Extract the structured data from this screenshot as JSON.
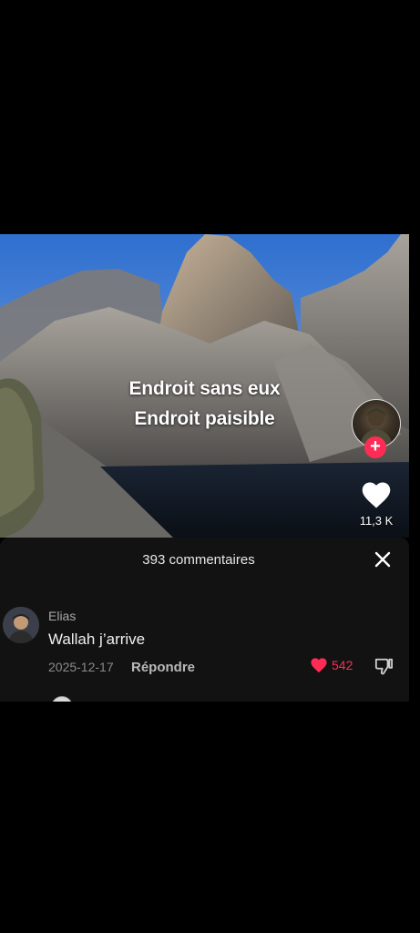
{
  "video": {
    "caption_line1": "Endroit sans eux",
    "caption_line2": "Endroit paisible",
    "like_count": "11,3 K"
  },
  "comments_sheet": {
    "title": "393 commentaires",
    "comment": {
      "username": "Elias",
      "text": "Wallah j’arrive",
      "date": "2025-12-17",
      "reply_label": "Répondre",
      "like_count": "542"
    }
  },
  "colors": {
    "accent": "#fe2c55",
    "sheet_bg": "#121212"
  },
  "icons": [
    "plus-icon",
    "heart-icon",
    "close-icon",
    "dislike-icon"
  ]
}
